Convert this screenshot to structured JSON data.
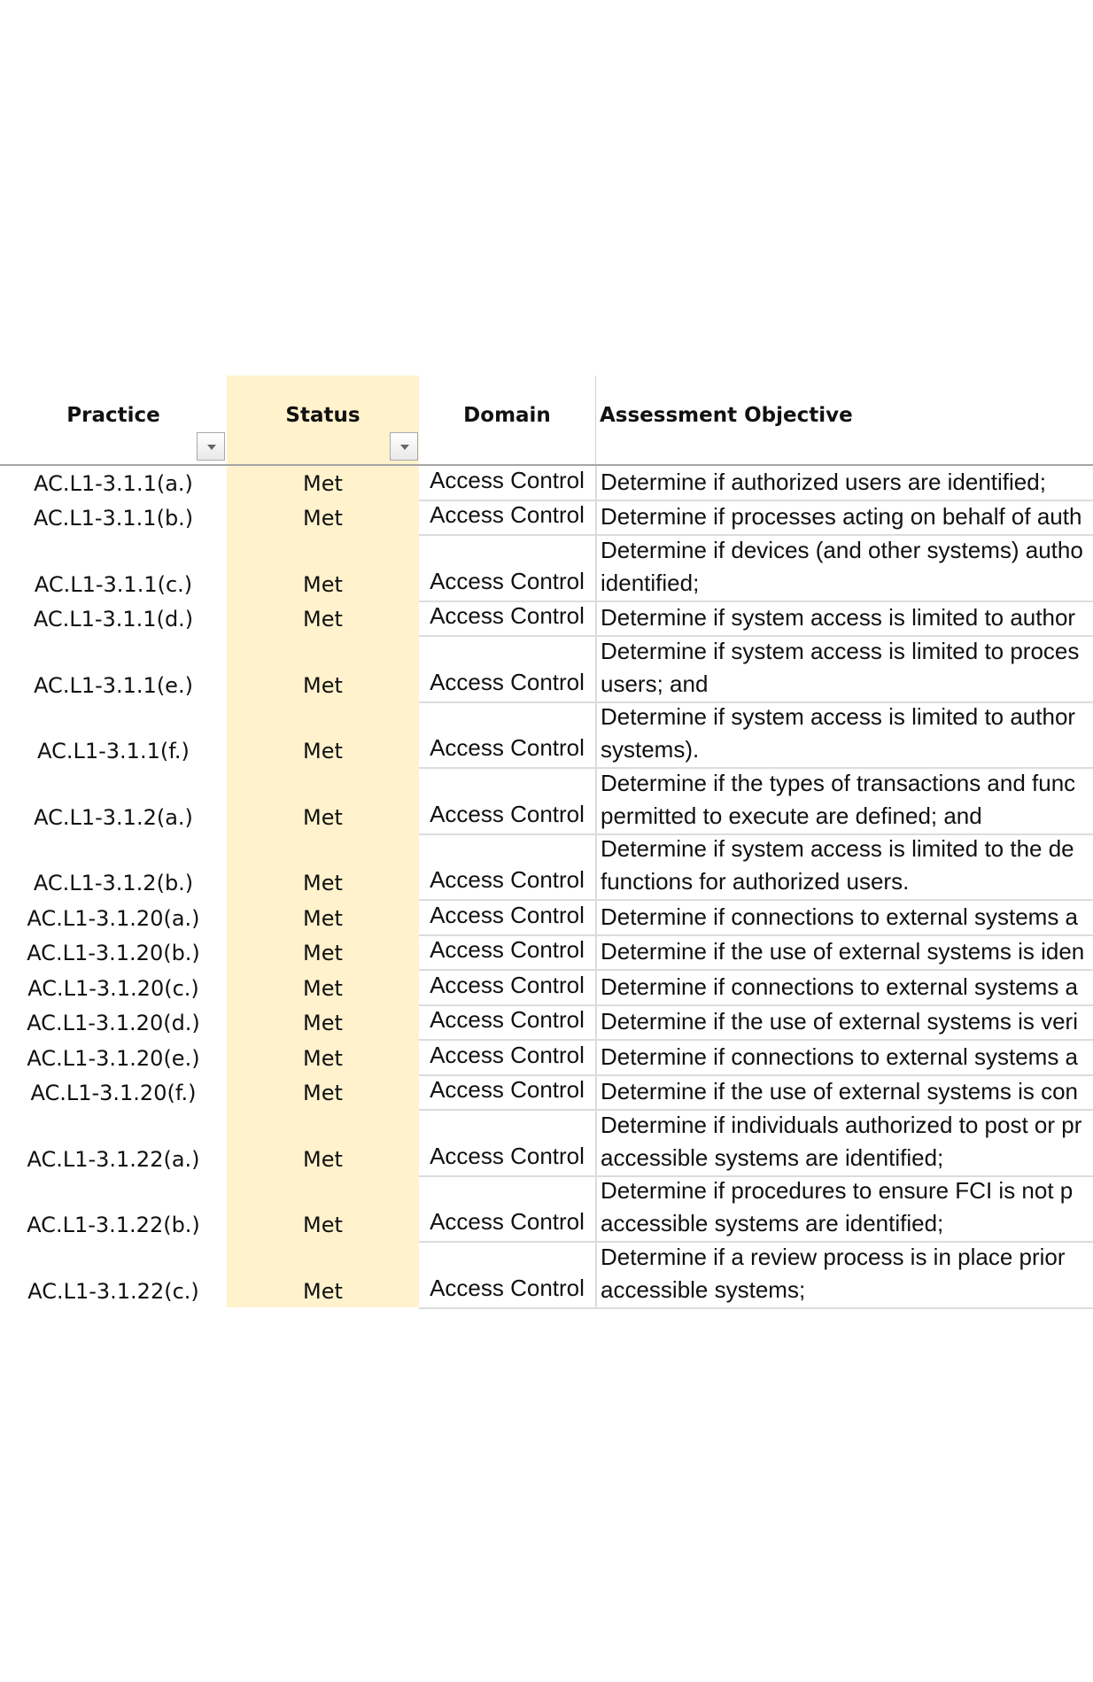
{
  "header": {
    "practice": "Practice",
    "status": "Status",
    "domain": "Domain",
    "objective": "Assessment Objective",
    "filter_icon": "dropdown-arrow-icon"
  },
  "colors": {
    "status_fill": "#FFF2CC",
    "gridline": "#DCDCDC",
    "header_rule": "#A6A6A6"
  },
  "rows": [
    {
      "practice": "AC.L1-3.1.1(a.)",
      "status": "Met",
      "domain": "Access Control",
      "lines": [
        "Determine if authorized users are identified;"
      ]
    },
    {
      "practice": "AC.L1-3.1.1(b.)",
      "status": "Met",
      "domain": "Access Control",
      "lines": [
        "Determine if processes acting on behalf of auth"
      ]
    },
    {
      "practice": "AC.L1-3.1.1(c.)",
      "status": "Met",
      "domain": "Access Control",
      "lines": [
        "Determine if devices (and other systems) autho",
        "identified;"
      ]
    },
    {
      "practice": "AC.L1-3.1.1(d.)",
      "status": "Met",
      "domain": "Access Control",
      "lines": [
        "Determine if system access is limited to author"
      ]
    },
    {
      "practice": "AC.L1-3.1.1(e.)",
      "status": "Met",
      "domain": "Access Control",
      "lines": [
        "Determine if system access is limited to proces",
        "users; and"
      ]
    },
    {
      "practice": "AC.L1-3.1.1(f.)",
      "status": "Met",
      "domain": "Access Control",
      "lines": [
        "Determine if system access is limited to author",
        "systems)."
      ]
    },
    {
      "practice": "AC.L1-3.1.2(a.)",
      "status": "Met",
      "domain": "Access Control",
      "lines": [
        "Determine if the types of transactions and func",
        "permitted to execute are defined; and"
      ]
    },
    {
      "practice": "AC.L1-3.1.2(b.)",
      "status": "Met",
      "domain": "Access Control",
      "lines": [
        "Determine if system access is limited to the de",
        "functions for authorized users."
      ]
    },
    {
      "practice": "AC.L1-3.1.20(a.)",
      "status": "Met",
      "domain": "Access Control",
      "lines": [
        "Determine if connections to external systems a"
      ]
    },
    {
      "practice": "AC.L1-3.1.20(b.)",
      "status": "Met",
      "domain": "Access Control",
      "lines": [
        "Determine if the use of external systems is iden"
      ]
    },
    {
      "practice": "AC.L1-3.1.20(c.)",
      "status": "Met",
      "domain": "Access Control",
      "lines": [
        "Determine if connections to external systems a"
      ]
    },
    {
      "practice": "AC.L1-3.1.20(d.)",
      "status": "Met",
      "domain": "Access Control",
      "lines": [
        "Determine if the use of external systems is veri"
      ]
    },
    {
      "practice": "AC.L1-3.1.20(e.)",
      "status": "Met",
      "domain": "Access Control",
      "lines": [
        "Determine if connections to external systems a"
      ]
    },
    {
      "practice": "AC.L1-3.1.20(f.)",
      "status": "Met",
      "domain": "Access Control",
      "lines": [
        "Determine if the use of external systems is con"
      ]
    },
    {
      "practice": "AC.L1-3.1.22(a.)",
      "status": "Met",
      "domain": "Access Control",
      "lines": [
        "Determine if individuals authorized to post or pr",
        "accessible systems are identified;"
      ]
    },
    {
      "practice": "AC.L1-3.1.22(b.)",
      "status": "Met",
      "domain": "Access Control",
      "lines": [
        "Determine if procedures to ensure FCI is not p",
        "accessible systems are identified;"
      ]
    },
    {
      "practice": "AC.L1-3.1.22(c.)",
      "status": "Met",
      "domain": "Access Control",
      "lines": [
        "Determine if a review process is in place prior ",
        "accessible systems;"
      ]
    }
  ]
}
